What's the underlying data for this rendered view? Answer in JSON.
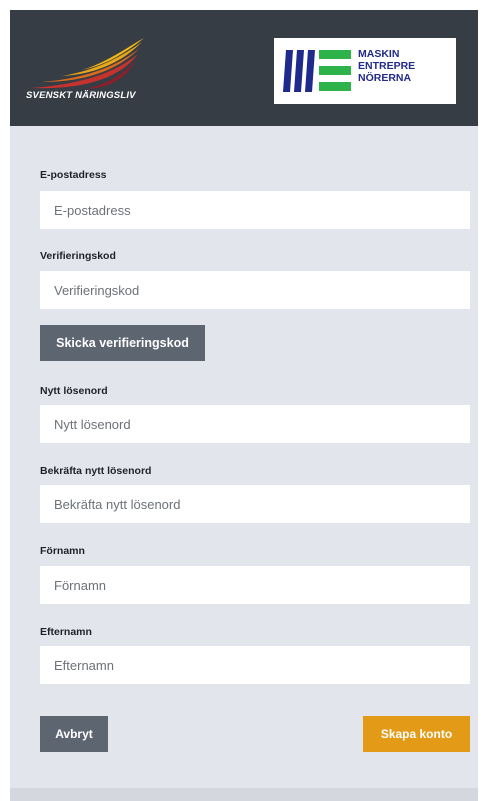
{
  "header": {
    "logo_left_text": "SVENSKT NÄRINGSLIV",
    "logo_right_lines": [
      "MASKIN",
      "ENTREPRE",
      "NÖRERNA"
    ],
    "accent_colors": {
      "dark_blue": "#1f2a8c",
      "green": "#2db34a",
      "yellow": "#f2b814",
      "red": "#c6322e"
    }
  },
  "form": {
    "email": {
      "label": "E-postadress",
      "placeholder": "E-postadress"
    },
    "verification": {
      "label": "Verifieringskod",
      "placeholder": "Verifieringskod"
    },
    "send_code_button": "Skicka verifieringskod",
    "new_password": {
      "label": "Nytt lösenord",
      "placeholder": "Nytt lösenord"
    },
    "confirm_password": {
      "label": "Bekräfta nytt lösenord",
      "placeholder": "Bekräfta nytt lösenord"
    },
    "first_name": {
      "label": "Förnamn",
      "placeholder": "Förnamn"
    },
    "last_name": {
      "label": "Efternamn",
      "placeholder": "Efternamn"
    }
  },
  "actions": {
    "cancel_label": "Avbryt",
    "create_label": "Skapa konto",
    "colors": {
      "cancel": "#5d6571",
      "create": "#e39b17"
    }
  }
}
